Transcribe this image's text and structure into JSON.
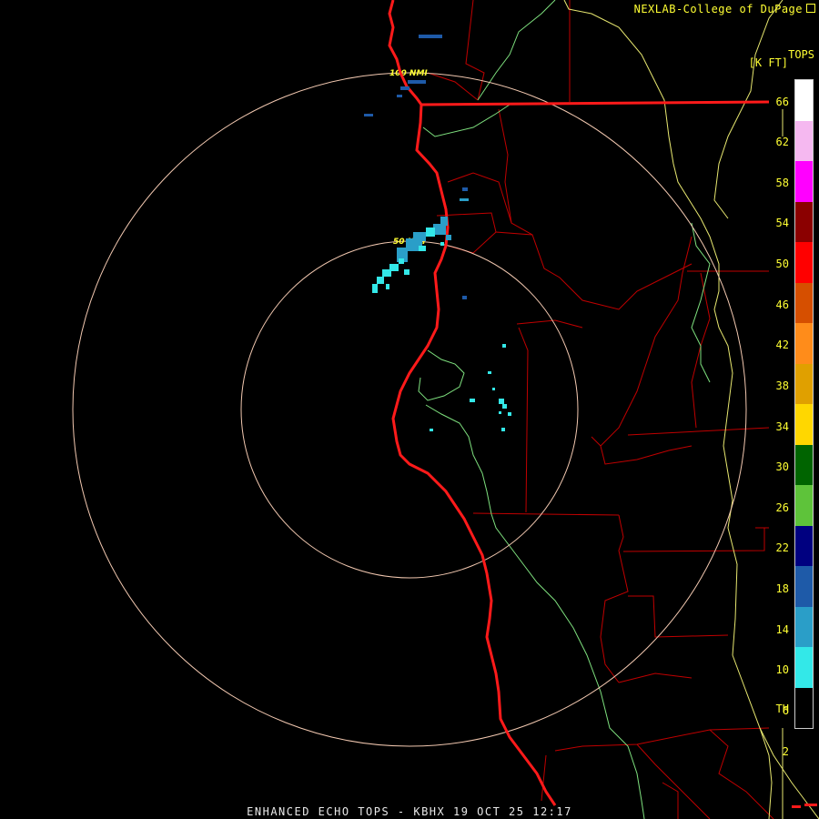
{
  "credit": "NEXLAB-College of DuPage",
  "product_title": "ENHANCED ECHO TOPS - KBHX 19 OCT 25 12:17",
  "legend": {
    "title_line1": "TOPS",
    "title_line2": "[K FT]",
    "ticks": [
      "66",
      "62",
      "58",
      "54",
      "50",
      "46",
      "42",
      "38",
      "34",
      "30",
      "26",
      "22",
      "18",
      "14",
      "10",
      "6",
      "2",
      "TH"
    ],
    "segments": [
      "#ffffff",
      "#f5b8f0",
      "#ff00ff",
      "#8b0000",
      "#ff0000",
      "#d64f00",
      "#ff8c1a",
      "#e0a000",
      "#ffd700",
      "#006400",
      "#5ec33a",
      "#000080",
      "#1e5aa8",
      "#2a9ec8",
      "#33e8e8",
      "#000000"
    ]
  },
  "range_rings": [
    {
      "label": "50 NMI",
      "range_nmi": 50
    },
    {
      "label": "100 NMI",
      "range_nmi": 100
    }
  ],
  "colors": {
    "text": "#ffff33",
    "ring": "#f2c8b0",
    "state_border": "#ff1a1a",
    "county_border": "#c00000",
    "neighbor_state": "#e8e870",
    "river": "#7ee07e"
  },
  "echo_colors": {
    "low": "#33e8e8",
    "mid": "#2a9ec8",
    "high": "#1e5aa8",
    "top": "#000080"
  }
}
